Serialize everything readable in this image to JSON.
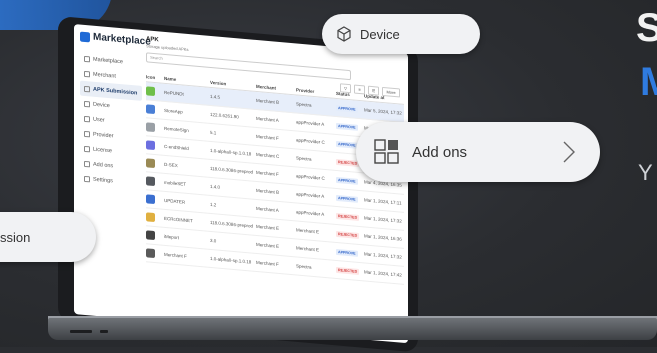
{
  "app": {
    "name": "Marketplace",
    "brand_color": "#1f6ad6"
  },
  "sidebar": {
    "items": [
      {
        "label": "Marketplace"
      },
      {
        "label": "Merchant"
      },
      {
        "label": "APK Submission",
        "active": true
      },
      {
        "label": "Device"
      },
      {
        "label": "User"
      },
      {
        "label": "Provider"
      },
      {
        "label": "License"
      },
      {
        "label": "Add ons"
      },
      {
        "label": "Settings"
      }
    ]
  },
  "main": {
    "title": "APK",
    "subtitle": "Storage uploaded APKs",
    "search_placeholder": "Search",
    "toolbar": {
      "more_label": "More"
    },
    "columns": [
      "Icon",
      "Name",
      "Version",
      "Merchant",
      "Provider",
      "Status",
      "Update at"
    ],
    "rows": [
      {
        "icon_color": "#6fbf4a",
        "name": "RePUNDt",
        "version": "1.4.5",
        "merchant": "Merchant B",
        "provider": "Spectra",
        "status": "APPROVE",
        "updated": "Mar 5, 2024, 17:32",
        "selected": true
      },
      {
        "icon_color": "#4a7fd6",
        "name": "StoreApp",
        "version": "122.0.6261.90",
        "merchant": "Merchant A",
        "provider": "appProvider A",
        "status": "APPROVE",
        "updated": "Mar 5, 2024, 16:30"
      },
      {
        "icon_color": "#9aa0a6",
        "name": "RemoteSign",
        "version": "5.1",
        "merchant": "Merchant F",
        "provider": "appProvider C",
        "status": "APPROVE",
        "updated": "Mar 1, 2024, 17:37"
      },
      {
        "icon_color": "#6c6fe0",
        "name": "C-endShield",
        "version": "1.0-alpha0-sp.1.0.18",
        "merchant": "Merchant C",
        "provider": "Spectra",
        "status": "REJECTED",
        "updated": "Mar 1, 2024, 15:59"
      },
      {
        "icon_color": "#9a8a55",
        "name": "D-SEX",
        "version": "118.0.6.3086-preprod",
        "merchant": "Merchant F",
        "provider": "appProvider C",
        "status": "APPROVE",
        "updated": "Mar 4, 2024, 16:35"
      },
      {
        "icon_color": "#55595f",
        "name": "mobileSET",
        "version": "1.4.0",
        "merchant": "Merchant B",
        "provider": "appProvider A",
        "status": "APPROVE",
        "updated": "Mar 1, 2024, 17:11"
      },
      {
        "icon_color": "#3b6fd0",
        "name": "UPDATER",
        "version": "1.2",
        "merchant": "Merchant A",
        "provider": "appProvider A",
        "status": "REJECTED",
        "updated": "Mar 1, 2024, 17:32"
      },
      {
        "icon_color": "#e0b040",
        "name": "ECRcOINNET",
        "version": "118.0.6.3086-preprod",
        "merchant": "Merchant E",
        "provider": "Merchant E",
        "status": "REJECTED",
        "updated": "Mar 1, 2024, 16:36"
      },
      {
        "icon_color": "#444444",
        "name": "iMeport",
        "version": "3.0",
        "merchant": "Merchant E",
        "provider": "Merchant E",
        "status": "APPROVE",
        "updated": "Mar 1, 2024, 17:32"
      },
      {
        "icon_color": "#5a5a5a",
        "name": "Merchant F",
        "version": "1.0-alpha0-sp.1.0.18",
        "merchant": "Merchant F",
        "provider": "Spectra",
        "status": "REJECTED",
        "updated": "Mar 1, 2024, 17:42"
      }
    ]
  },
  "pills": {
    "device": {
      "label": "Device",
      "icon": "cube-icon"
    },
    "addons": {
      "label": "Add ons",
      "icon": "grid-icon"
    },
    "submission": {
      "label": "ssion"
    }
  },
  "headline": {
    "s": "S",
    "m": "M",
    "y": "Y"
  },
  "colors": {
    "accent": "#2f7be0",
    "approve": "#2d62c8",
    "reject": "#d23b3b"
  }
}
